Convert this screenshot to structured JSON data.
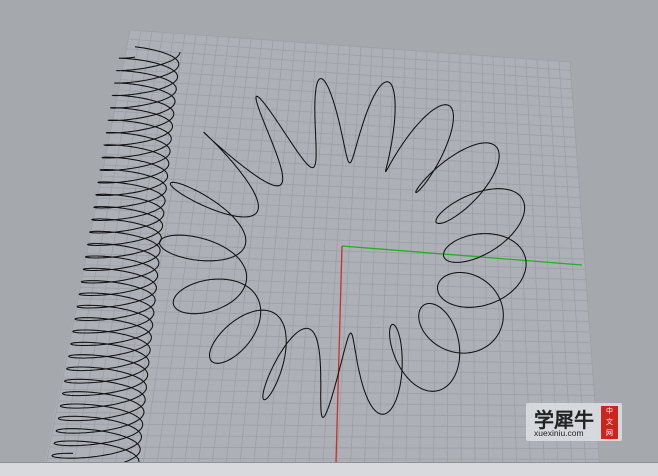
{
  "viewport": {
    "view": "perspective",
    "background": "#a5a8ad",
    "grid": {
      "line_color": "#9c9fa5",
      "plane_color": "#adb0b6",
      "divisions": 40
    },
    "axes": {
      "x_color": "#22b022",
      "y_color": "#c8322a"
    },
    "curves": [
      {
        "name": "helix-spring-curve",
        "color": "#111111"
      },
      {
        "name": "rose-torus-curve",
        "color": "#111111"
      }
    ]
  },
  "watermark": {
    "title": "学犀牛",
    "url": "xuexiniu.com",
    "badge": [
      "中",
      "文",
      "网"
    ],
    "badge_color": "#c8261f"
  }
}
